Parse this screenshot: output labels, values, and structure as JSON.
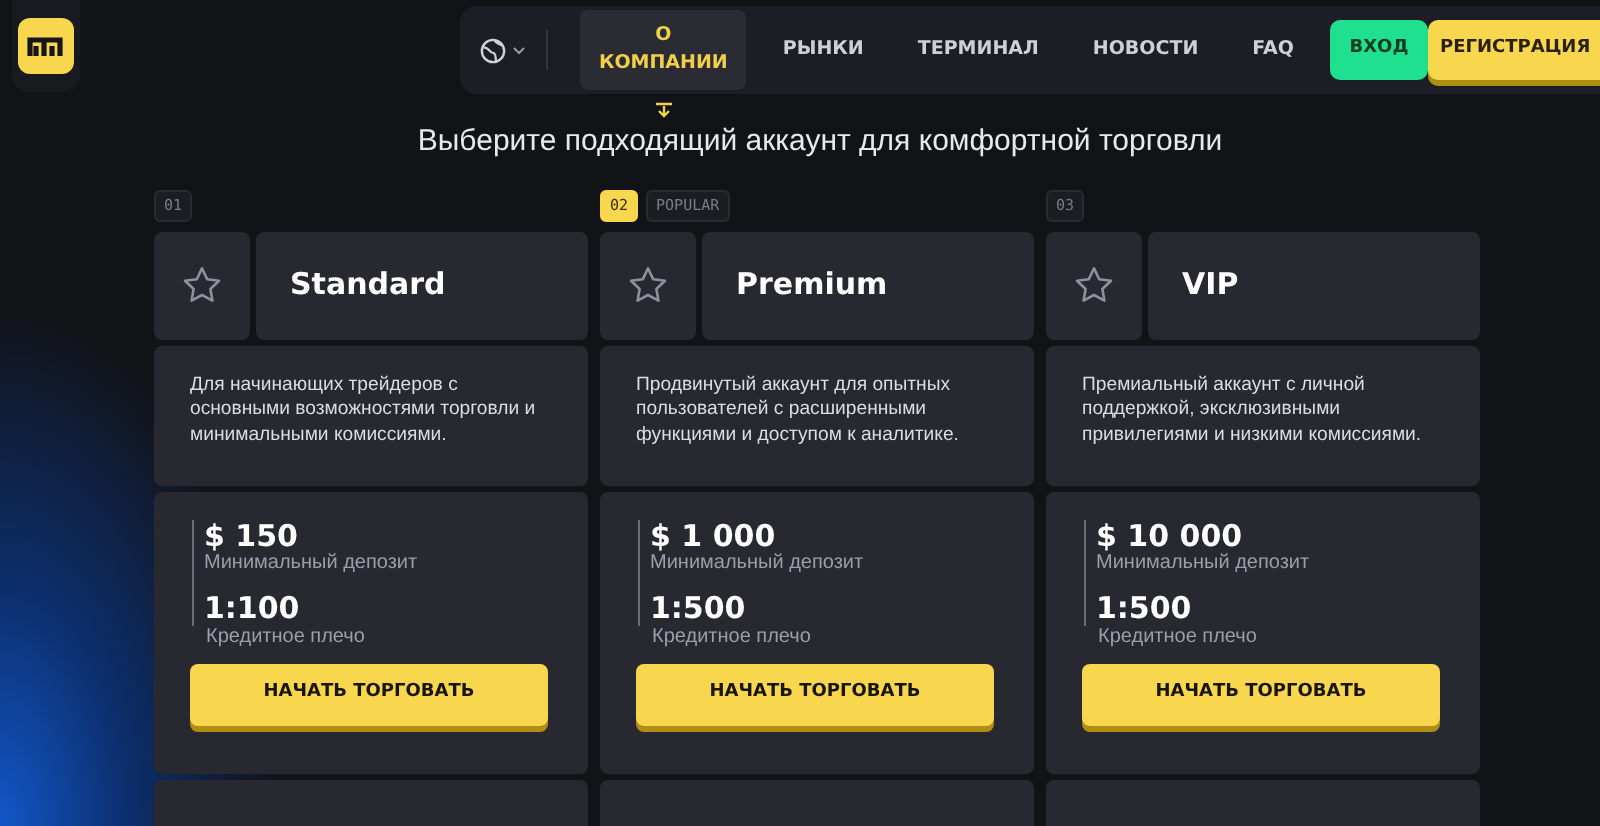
{
  "nav": {
    "items": [
      {
        "label": "О КОМПАНИИ",
        "selected": true
      },
      {
        "label": "РЫНКИ",
        "selected": false
      },
      {
        "label": "ТЕРМИНАЛ",
        "selected": false
      },
      {
        "label": "НОВОСТИ",
        "selected": false
      },
      {
        "label": "FAQ",
        "selected": false
      }
    ],
    "login": "ВХОД",
    "register": "РЕГИСТРАЦИЯ"
  },
  "heading": "Выберите подходящий аккаунт для комфортной торговли",
  "plans": [
    {
      "number": "01",
      "highlighted": false,
      "name": "Standard",
      "description": "Для начинающих трейдеров с основными возможностями торговли и минимальными комиссиями.",
      "deposit": "$ 150",
      "deposit_label": "Минимальный депозит",
      "leverage": "1:100",
      "leverage_label": "Кредитное плечо",
      "button": "НАЧАТЬ ТОРГОВАТЬ"
    },
    {
      "number": "02",
      "highlighted": true,
      "badge": "POPULAR",
      "name": "Premium",
      "description": "Продвинутый аккаунт для опытных пользователей с расширенными функциями и доступом к аналитике.",
      "deposit": "$ 1 000",
      "deposit_label": "Минимальный депозит",
      "leverage": "1:500",
      "leverage_label": "Кредитное плечо",
      "button": "НАЧАТЬ ТОРГОВАТЬ"
    },
    {
      "number": "03",
      "highlighted": false,
      "name": "VIP",
      "description": "Премиальный аккаунт с личной поддержкой, эксклюзивными привилегиями и низкими комиссиями.",
      "deposit": "$ 10 000",
      "deposit_label": "Минимальный депозит",
      "leverage": "1:500",
      "leverage_label": "Кредитное плечо",
      "button": "НАЧАТЬ ТОРГОВАТЬ"
    }
  ]
}
